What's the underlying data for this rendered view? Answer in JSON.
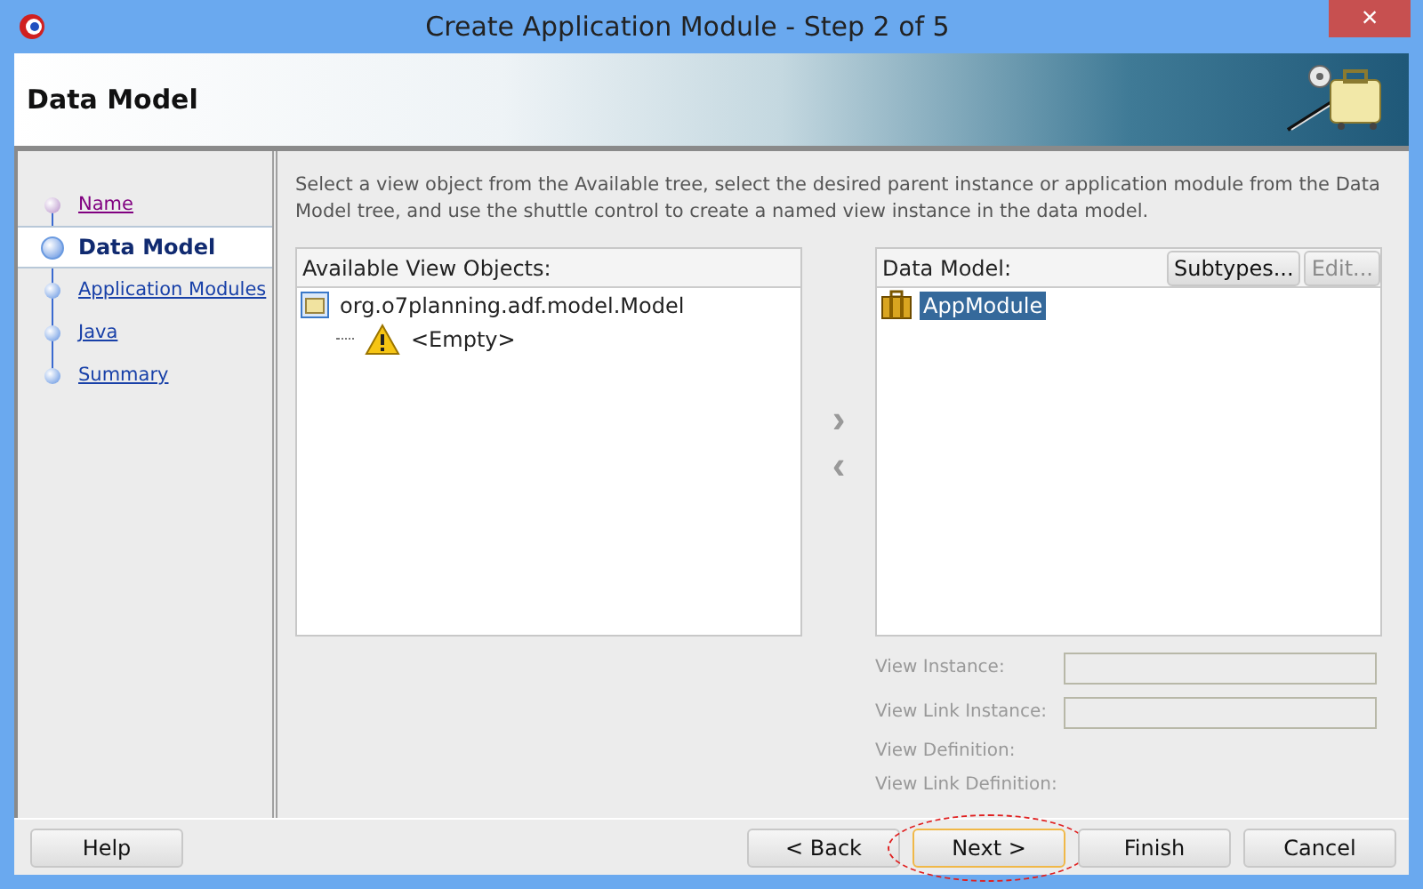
{
  "window": {
    "title": "Create Application Module - Step 2 of 5",
    "close": "×"
  },
  "header": {
    "title": "Data Model"
  },
  "steps": [
    {
      "label": "Name",
      "selected": false,
      "visited": true
    },
    {
      "label": "Data Model",
      "selected": true,
      "visited": false
    },
    {
      "label": "Application Modules",
      "selected": false,
      "visited": false
    },
    {
      "label": "Java",
      "selected": false,
      "visited": false
    },
    {
      "label": "Summary",
      "selected": false,
      "visited": false
    }
  ],
  "instructions": "Select a view object from the Available tree, select the desired parent instance or application module from the Data Model tree, and use the shuttle control to create a named view instance in the data model.",
  "available": {
    "title": "Available View Objects:",
    "items": [
      {
        "label": "org.o7planning.adf.model.Model",
        "kind": "package",
        "selected": false,
        "children": [
          {
            "label": "<Empty>",
            "kind": "warning",
            "selected": false
          }
        ]
      }
    ]
  },
  "shuttle": [
    {
      "symbol": "›",
      "disabled": true
    },
    {
      "symbol": "‹",
      "disabled": true
    }
  ],
  "data_model": {
    "title": "Data Model:",
    "buttons": [
      {
        "label": "Subtypes...",
        "disabled": false
      },
      {
        "label": "Edit...",
        "disabled": true
      }
    ],
    "items": [
      {
        "label": "AppModule",
        "kind": "module",
        "selected": true
      }
    ]
  },
  "fields": [
    {
      "label": "View Instance:",
      "kind": "input",
      "disabled": true
    },
    {
      "label": "View Link Instance:",
      "kind": "input",
      "disabled": true
    },
    {
      "label": "View Definition:",
      "kind": "text",
      "disabled": true
    },
    {
      "label": "View Link Definition:",
      "kind": "text",
      "disabled": true
    }
  ],
  "help_button": {
    "label": "Help",
    "circled": false
  },
  "buttons": [
    {
      "label": "< Back",
      "circled": false
    },
    {
      "label": "Next >",
      "circled": true
    },
    {
      "label": "Finish",
      "circled": false
    },
    {
      "label": "Cancel",
      "circled": false
    }
  ]
}
